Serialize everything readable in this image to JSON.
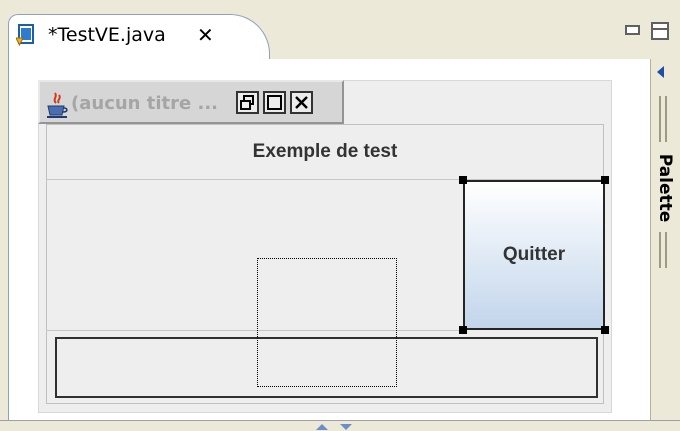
{
  "editor": {
    "tab_label": "*TestVE.java",
    "tab_close": "✕"
  },
  "palette": {
    "label": "Palette"
  },
  "frame": {
    "title": "(aucun titre ...",
    "north_label": "Exemple de test",
    "quit_button_label": "Quitter",
    "text_field_value": ""
  },
  "colors": {
    "chrome_background": "#ece9d8",
    "editor_background": "#ffffff",
    "button_gradient_top": "#ffffff",
    "button_gradient_bottom": "#c2d5eb",
    "palette_arrow": "#1c4ea8"
  },
  "icons": {
    "tab": "java-file-icon",
    "frame": "java-coffee-cup-icon",
    "window_buttons": [
      "restore-icon",
      "maximize-icon",
      "close-icon"
    ]
  }
}
